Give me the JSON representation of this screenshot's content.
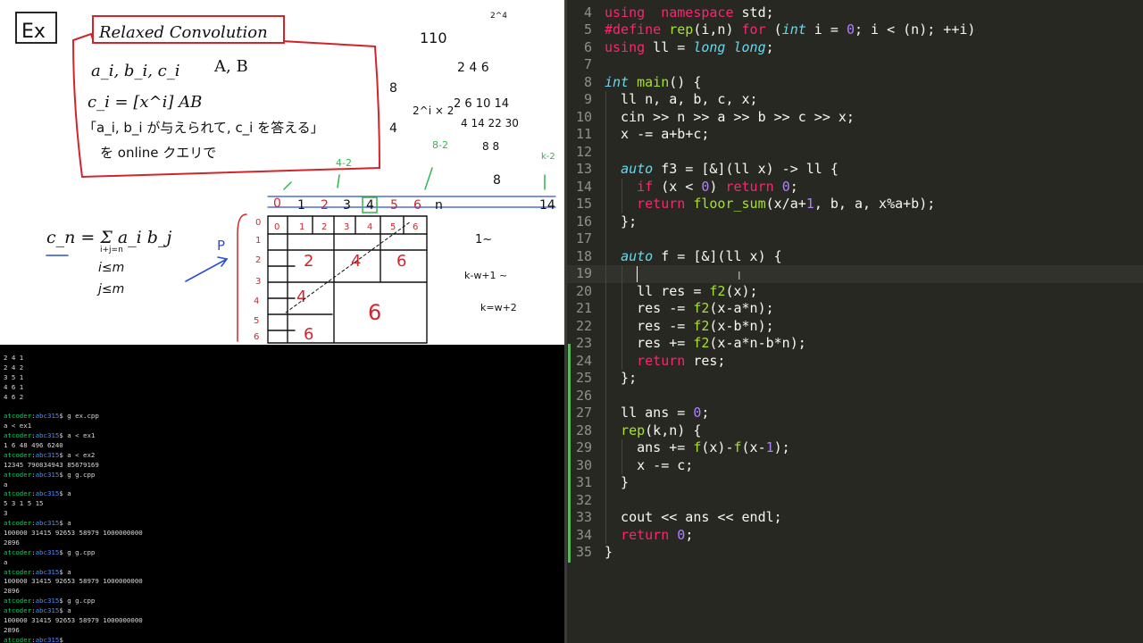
{
  "whiteboard": {
    "ex_label": "Ex",
    "box_title": "Relaxed Convolution",
    "box_line1_left": "a_i, b_i, c_i",
    "box_line1_right": "A, B",
    "box_line2": "c_i = [x^i] AB",
    "box_line3": "「a_i, b_i が与えられて, c_i を答える」",
    "box_line4": "を online クエリで",
    "formula_main": "c_n = Σ a_i b_j",
    "formula_sub": "i+j=n",
    "cond_i": "i≤m",
    "cond_j": "j≤m",
    "top_number": "110",
    "top_corner": "2^4",
    "label_p": "P",
    "label_8": "8",
    "label_4": "4",
    "label_2i": "2^i × 2",
    "label_green_left": "8-2",
    "label_green_top": "4-2",
    "label_green_k": "k-2",
    "label_1": "1~",
    "label_kw1": "k-w+1 ~",
    "label_kw2": "k=w+2",
    "ruler_numbers": [
      "0",
      "1",
      "2",
      "3",
      "4",
      "5",
      "6",
      "n",
      "14"
    ],
    "grid_col_numbers": [
      "0",
      "1",
      "2",
      "3",
      "4",
      "5",
      "6"
    ],
    "grid_row_numbers": [
      "0",
      "1",
      "2",
      "3",
      "4",
      "5",
      "6"
    ],
    "block_labels": [
      "2",
      "4",
      "6",
      "4",
      "6",
      "6"
    ],
    "seq_row1": "2 4 6",
    "seq_row2": "2 6 10 14",
    "seq_row3": "4 14 22 30",
    "seq_row4": "8 8"
  },
  "terminal": {
    "lines": [
      {
        "text": "2 4 1"
      },
      {
        "text": "2 4 2"
      },
      {
        "text": "3 5 1"
      },
      {
        "text": "4 6 1"
      },
      {
        "text": "4 6 2"
      },
      {
        "text": ""
      },
      {
        "user": "atcoder",
        "dir": "abc315",
        "cmd": "$ g ex.cpp"
      },
      {
        "text": "a < ex1"
      },
      {
        "user": "atcoder",
        "dir": "abc315",
        "cmd": "$ a < ex1"
      },
      {
        "text": "1 6 48 496 6240"
      },
      {
        "user": "atcoder",
        "dir": "abc315",
        "cmd": "$ a < ex2"
      },
      {
        "text": "12345 790834943 85679169"
      },
      {
        "user": "atcoder",
        "dir": "abc315",
        "cmd": "$ g g.cpp"
      },
      {
        "text": "a"
      },
      {
        "user": "atcoder",
        "dir": "abc315",
        "cmd": "$ a"
      },
      {
        "text": "5 3 1 5 15"
      },
      {
        "text": "3"
      },
      {
        "user": "atcoder",
        "dir": "abc315",
        "cmd": "$ a"
      },
      {
        "text": "100000 31415 92653 58979 1000000000"
      },
      {
        "text": "2896"
      },
      {
        "user": "atcoder",
        "dir": "abc315",
        "cmd": "$ g g.cpp"
      },
      {
        "text": "a"
      },
      {
        "user": "atcoder",
        "dir": "abc315",
        "cmd": "$ a"
      },
      {
        "text": "100000 31415 92653 58979 1000000000"
      },
      {
        "text": "2896"
      },
      {
        "user": "atcoder",
        "dir": "abc315",
        "cmd": "$ g g.cpp"
      },
      {
        "user": "atcoder",
        "dir": "abc315",
        "cmd": "$ a"
      },
      {
        "text": "100000 31415 92653 58979 1000000000"
      },
      {
        "text": "2896"
      },
      {
        "user": "atcoder",
        "dir": "abc315",
        "cmd": "$"
      }
    ]
  },
  "editor": {
    "active_line": 19,
    "lines": [
      {
        "n": "4",
        "t": [
          [
            "kw",
            "using"
          ],
          [
            "",
            "  "
          ],
          [
            "kw",
            "namespace"
          ],
          [
            "",
            " std;"
          ]
        ]
      },
      {
        "n": "5",
        "t": [
          [
            "kw",
            "#define"
          ],
          [
            "",
            " "
          ],
          [
            "fn",
            "rep"
          ],
          [
            "",
            "(i,n) "
          ],
          [
            "kw",
            "for"
          ],
          [
            "",
            " ("
          ],
          [
            "ty",
            "int"
          ],
          [
            "",
            " i = "
          ],
          [
            "nu",
            "0"
          ],
          [
            "",
            "; i < (n); ++i)"
          ]
        ]
      },
      {
        "n": "6",
        "t": [
          [
            "kw",
            "using"
          ],
          [
            "",
            " ll = "
          ],
          [
            "ty",
            "long long"
          ],
          [
            "",
            ";"
          ]
        ]
      },
      {
        "n": "7",
        "t": []
      },
      {
        "n": "8",
        "t": [
          [
            "ty",
            "int"
          ],
          [
            "",
            " "
          ],
          [
            "fn",
            "main"
          ],
          [
            "",
            "() {"
          ]
        ]
      },
      {
        "n": "9",
        "t": [
          [
            "",
            "  ll n, a, b, c, x;"
          ]
        ]
      },
      {
        "n": "10",
        "t": [
          [
            "",
            "  cin >> n >> a >> b >> c >> x;"
          ]
        ]
      },
      {
        "n": "11",
        "t": [
          [
            "",
            "  x -= a+b+c;"
          ]
        ]
      },
      {
        "n": "12",
        "t": []
      },
      {
        "n": "13",
        "t": [
          [
            "",
            "  "
          ],
          [
            "ty",
            "auto"
          ],
          [
            "",
            " f3 = [&](ll x) -> ll {"
          ]
        ]
      },
      {
        "n": "14",
        "t": [
          [
            "",
            "    "
          ],
          [
            "kw",
            "if"
          ],
          [
            "",
            " (x < "
          ],
          [
            "nu",
            "0"
          ],
          [
            "",
            ") "
          ],
          [
            "kw",
            "return"
          ],
          [
            "",
            " "
          ],
          [
            "nu",
            "0"
          ],
          [
            "",
            ";"
          ]
        ]
      },
      {
        "n": "15",
        "t": [
          [
            "",
            "    "
          ],
          [
            "kw",
            "return"
          ],
          [
            "",
            " "
          ],
          [
            "fn",
            "floor_sum"
          ],
          [
            "",
            "(x/a+"
          ],
          [
            "nu",
            "1"
          ],
          [
            "",
            ", b, a, x%a+b);"
          ]
        ]
      },
      {
        "n": "16",
        "t": [
          [
            "",
            "  };"
          ]
        ]
      },
      {
        "n": "17",
        "t": []
      },
      {
        "n": "18",
        "t": [
          [
            "",
            "  "
          ],
          [
            "ty",
            "auto"
          ],
          [
            "",
            " f = [&](ll x) {"
          ]
        ]
      },
      {
        "n": "19",
        "t": []
      },
      {
        "n": "20",
        "t": [
          [
            "",
            "    ll res = "
          ],
          [
            "fn",
            "f2"
          ],
          [
            "",
            "(x);"
          ]
        ]
      },
      {
        "n": "21",
        "t": [
          [
            "",
            "    res -= "
          ],
          [
            "fn",
            "f2"
          ],
          [
            "",
            "(x-a*n);"
          ]
        ]
      },
      {
        "n": "22",
        "t": [
          [
            "",
            "    res -= "
          ],
          [
            "fn",
            "f2"
          ],
          [
            "",
            "(x-b*n);"
          ]
        ]
      },
      {
        "n": "23",
        "t": [
          [
            "",
            "    res += "
          ],
          [
            "fn",
            "f2"
          ],
          [
            "",
            "(x-a*n-b*n);"
          ]
        ]
      },
      {
        "n": "24",
        "t": [
          [
            "",
            "    "
          ],
          [
            "kw",
            "return"
          ],
          [
            "",
            " res;"
          ]
        ]
      },
      {
        "n": "25",
        "t": [
          [
            "",
            "  };"
          ]
        ]
      },
      {
        "n": "26",
        "t": []
      },
      {
        "n": "27",
        "t": [
          [
            "",
            "  ll ans = "
          ],
          [
            "nu",
            "0"
          ],
          [
            "",
            ";"
          ]
        ]
      },
      {
        "n": "28",
        "t": [
          [
            "",
            "  "
          ],
          [
            "fn",
            "rep"
          ],
          [
            "",
            "(k,n) {"
          ]
        ]
      },
      {
        "n": "29",
        "t": [
          [
            "",
            "    ans += "
          ],
          [
            "fn",
            "f"
          ],
          [
            "",
            "(x)-"
          ],
          [
            "fn",
            "f"
          ],
          [
            "",
            "(x-"
          ],
          [
            "nu",
            "1"
          ],
          [
            "",
            ");"
          ]
        ]
      },
      {
        "n": "30",
        "t": [
          [
            "",
            "    x -= c;"
          ]
        ]
      },
      {
        "n": "31",
        "t": [
          [
            "",
            "  }"
          ]
        ]
      },
      {
        "n": "32",
        "t": []
      },
      {
        "n": "33",
        "t": [
          [
            "",
            "  cout << ans << endl;"
          ]
        ]
      },
      {
        "n": "34",
        "t": [
          [
            "",
            "  "
          ],
          [
            "kw",
            "return"
          ],
          [
            "",
            " "
          ],
          [
            "nu",
            "0"
          ],
          [
            "",
            ";"
          ]
        ]
      },
      {
        "n": "35",
        "t": [
          [
            "",
            "}"
          ]
        ]
      }
    ]
  },
  "colors": {
    "ink": "#111111",
    "red_ink": "#d0262b",
    "green_ink": "#2fb84a",
    "blue_ink": "#2b4fd8",
    "editor_bg": "#272822",
    "terminal_bg": "#000000"
  }
}
